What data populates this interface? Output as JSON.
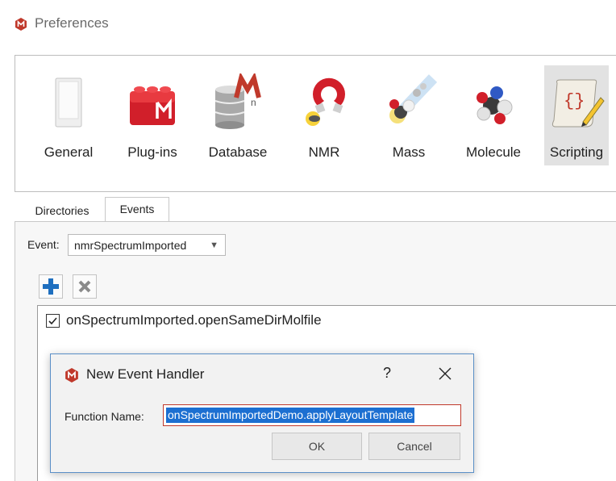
{
  "window": {
    "title": "Preferences",
    "logo_icon": "mestrenova-logo-icon"
  },
  "categories": [
    {
      "label": "General",
      "icon": "general-icon"
    },
    {
      "label": "Plug-ins",
      "icon": "plugins-icon"
    },
    {
      "label": "Database",
      "icon": "database-icon"
    },
    {
      "label": "NMR",
      "icon": "nmr-icon"
    },
    {
      "label": "Mass",
      "icon": "mass-icon"
    },
    {
      "label": "Molecule",
      "icon": "molecule-icon"
    },
    {
      "label": "Scripting",
      "icon": "scripting-icon",
      "selected": true
    }
  ],
  "tabs": [
    {
      "label": "Directories"
    },
    {
      "label": "Events",
      "active": true
    }
  ],
  "event": {
    "label": "Event:",
    "selected": "nmrSpectrumImported"
  },
  "toolbar": {
    "add_icon": "plus-icon",
    "remove_icon": "remove-icon"
  },
  "handlers": [
    {
      "checked": true,
      "text": "onSpectrumImported.openSameDirMolfile"
    }
  ],
  "dialog": {
    "title": "New Event Handler",
    "help": "?",
    "close_icon": "close-icon",
    "function_label": "Function Name:",
    "function_value": "onSpectrumImportedDemo.applyLayoutTemplate",
    "ok_label": "OK",
    "cancel_label": "Cancel"
  },
  "colors": {
    "accent": "#1c6fd1",
    "brand_red": "#c0392b",
    "dialog_border": "#5a8fc7"
  }
}
